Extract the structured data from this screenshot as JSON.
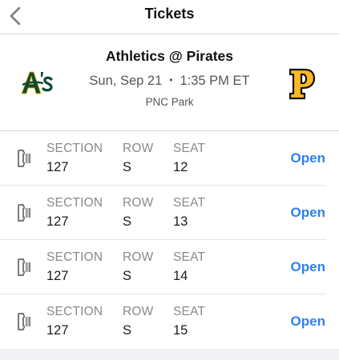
{
  "nav": {
    "title": "Tickets",
    "back_icon": "chevron-left-icon"
  },
  "event": {
    "title": "Athletics @ Pirates",
    "date": "Sun, Sep 21",
    "time": "1:35 PM ET",
    "separator": "•",
    "venue": "PNC Park",
    "away_logo": "athletics-logo",
    "home_logo": "pirates-logo"
  },
  "labels": {
    "section": "SECTION",
    "row": "ROW",
    "seat": "SEAT",
    "open": "Open"
  },
  "tickets": [
    {
      "section": "127",
      "row": "S",
      "seat": "12"
    },
    {
      "section": "127",
      "row": "S",
      "seat": "13"
    },
    {
      "section": "127",
      "row": "S",
      "seat": "14"
    },
    {
      "section": "127",
      "row": "S",
      "seat": "15"
    }
  ],
  "colors": {
    "accent": "#2f80ed",
    "athletics_green": "#0b4a36",
    "athletics_gold": "#efb21e",
    "pirates_gold": "#fdb827",
    "pirates_black": "#111111"
  }
}
